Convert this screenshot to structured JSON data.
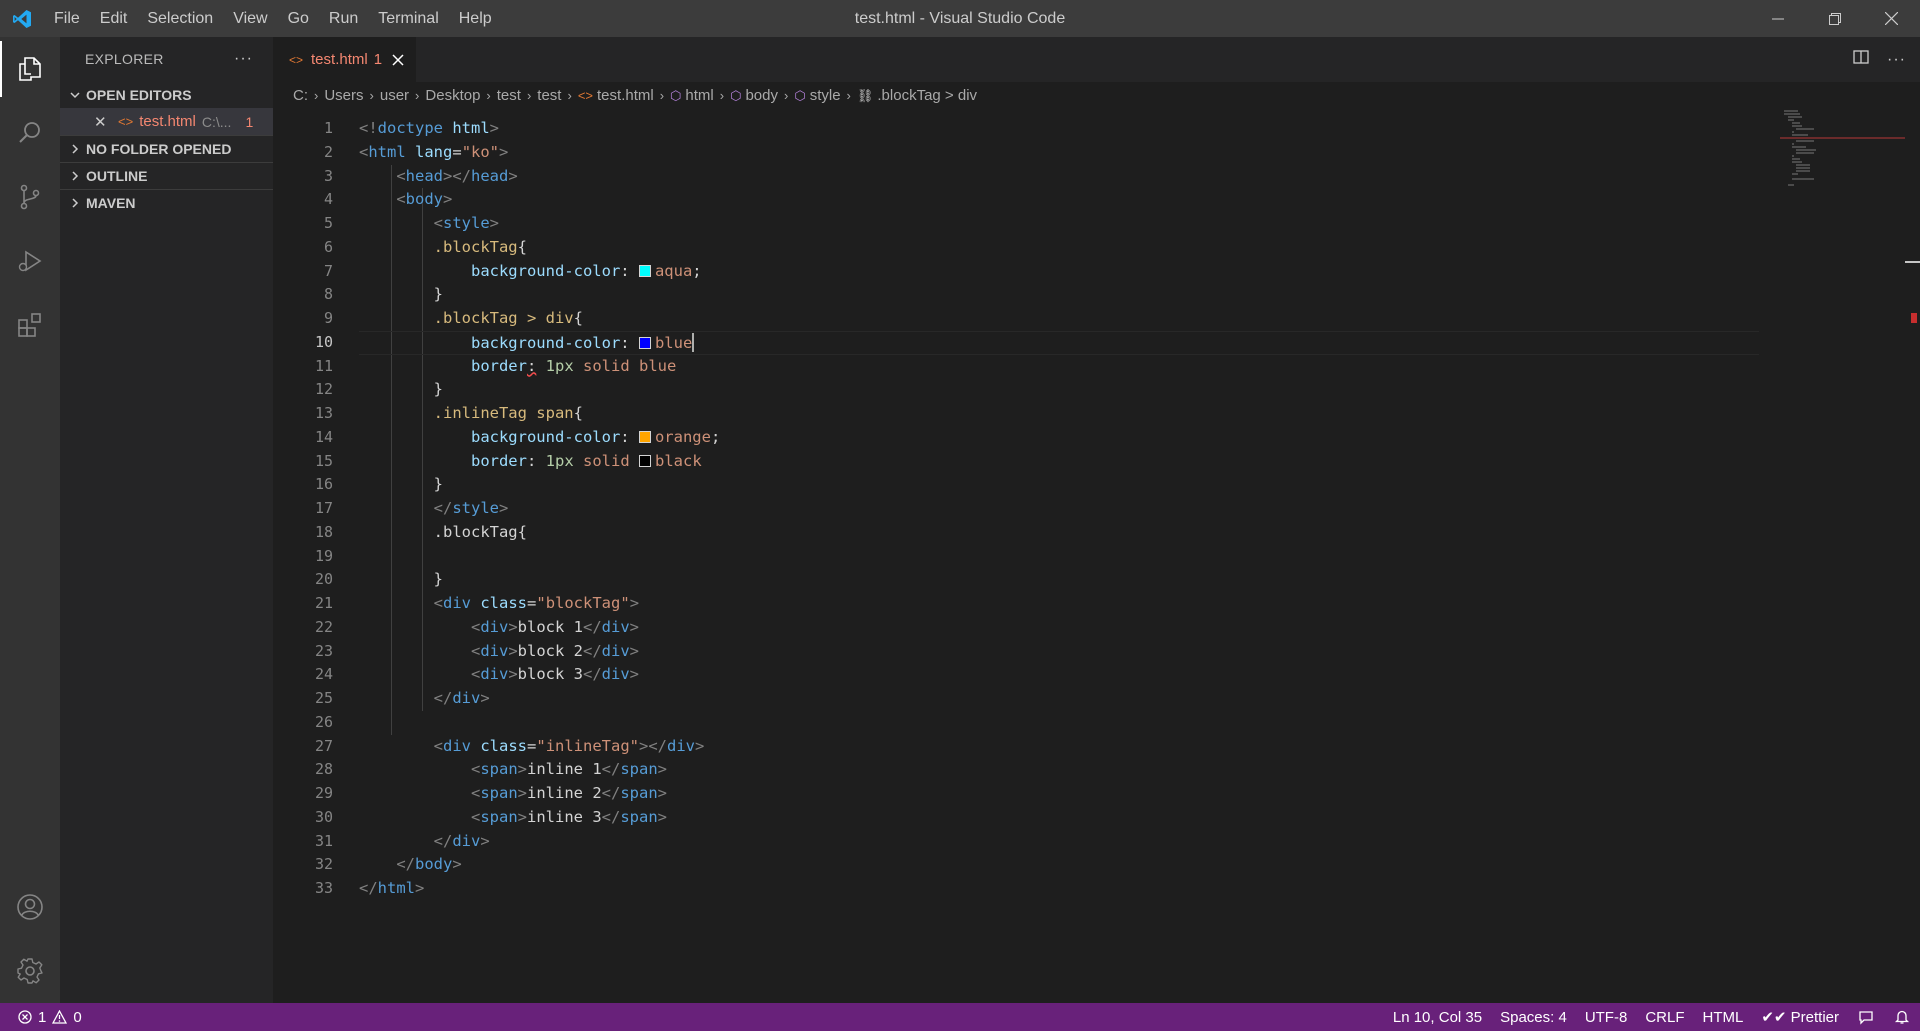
{
  "window": {
    "title": "test.html - Visual Studio Code",
    "menu": [
      "File",
      "Edit",
      "Selection",
      "View",
      "Go",
      "Run",
      "Terminal",
      "Help"
    ]
  },
  "sidebar": {
    "title": "EXPLORER",
    "more": "···",
    "sections": {
      "open_editors": "OPEN EDITORS",
      "no_folder": "NO FOLDER OPENED",
      "outline": "OUTLINE",
      "maven": "MAVEN"
    },
    "open_editor": {
      "name": "test.html",
      "path": "C:\\...",
      "badge": "1"
    }
  },
  "tab": {
    "name": "test.html",
    "badge": "1"
  },
  "breadcrumb": [
    "C:",
    "Users",
    "user",
    "Desktop",
    "test",
    "test",
    "test.html",
    "html",
    "body",
    "style",
    ".blockTag > div"
  ],
  "editor": {
    "current_line": 10,
    "lines": [
      [
        [
          "punc",
          "<!"
        ],
        [
          "tag",
          "doctype"
        ],
        [
          "text",
          " "
        ],
        [
          "attr",
          "html"
        ],
        [
          "punc",
          ">"
        ]
      ],
      [
        [
          "punc",
          "<"
        ],
        [
          "tag",
          "html"
        ],
        [
          "text",
          " "
        ],
        [
          "attr",
          "lang"
        ],
        [
          "text",
          "="
        ],
        [
          "str",
          "\"ko\""
        ],
        [
          "punc",
          ">"
        ]
      ],
      [
        [
          "text",
          "    "
        ],
        [
          "punc",
          "<"
        ],
        [
          "tag",
          "head"
        ],
        [
          "punc",
          "></"
        ],
        [
          "tag",
          "head"
        ],
        [
          "punc",
          ">"
        ]
      ],
      [
        [
          "text",
          "    "
        ],
        [
          "punc",
          "<"
        ],
        [
          "tag",
          "body"
        ],
        [
          "punc",
          ">"
        ]
      ],
      [
        [
          "text",
          "        "
        ],
        [
          "punc",
          "<"
        ],
        [
          "tag",
          "style"
        ],
        [
          "punc",
          ">"
        ]
      ],
      [
        [
          "text",
          "        "
        ],
        [
          "sel",
          ".blockTag"
        ],
        [
          "text",
          "{"
        ]
      ],
      [
        [
          "text",
          "            "
        ],
        [
          "prop",
          "background-color"
        ],
        [
          "text",
          ": "
        ],
        [
          "swatch",
          "#00ffff"
        ],
        [
          "val",
          "aqua"
        ],
        [
          "text",
          ";"
        ]
      ],
      [
        [
          "text",
          "        "
        ],
        [
          "text",
          "}"
        ]
      ],
      [
        [
          "text",
          "        "
        ],
        [
          "sel",
          ".blockTag > div"
        ],
        [
          "text",
          "{"
        ]
      ],
      [
        [
          "text",
          "            "
        ],
        [
          "prop",
          "background-color"
        ],
        [
          "text",
          ": "
        ],
        [
          "swatch",
          "#0000ff"
        ],
        [
          "val",
          "blue"
        ],
        [
          "caret",
          ""
        ]
      ],
      [
        [
          "text",
          "            "
        ],
        [
          "prop",
          "border"
        ],
        [
          "squig",
          ":"
        ],
        [
          "text",
          " "
        ],
        [
          "num",
          "1px"
        ],
        [
          "text",
          " "
        ],
        [
          "val",
          "solid blue"
        ]
      ],
      [
        [
          "text",
          "        "
        ],
        [
          "text",
          "}"
        ]
      ],
      [
        [
          "text",
          "        "
        ],
        [
          "sel",
          ".inlineTag span"
        ],
        [
          "text",
          "{"
        ]
      ],
      [
        [
          "text",
          "            "
        ],
        [
          "prop",
          "background-color"
        ],
        [
          "text",
          ": "
        ],
        [
          "swatch",
          "#ffa500"
        ],
        [
          "val",
          "orange"
        ],
        [
          "text",
          ";"
        ]
      ],
      [
        [
          "text",
          "            "
        ],
        [
          "prop",
          "border"
        ],
        [
          "text",
          ": "
        ],
        [
          "num",
          "1px"
        ],
        [
          "text",
          " "
        ],
        [
          "val",
          "solid "
        ],
        [
          "swatch",
          "#000000"
        ],
        [
          "val",
          "black"
        ]
      ],
      [
        [
          "text",
          "        "
        ],
        [
          "text",
          "}"
        ]
      ],
      [
        [
          "text",
          "        "
        ],
        [
          "punc",
          "</"
        ],
        [
          "tag",
          "style"
        ],
        [
          "punc",
          ">"
        ]
      ],
      [
        [
          "text",
          "        "
        ],
        [
          "text",
          ".blockTag{"
        ]
      ],
      [
        [
          "text",
          ""
        ]
      ],
      [
        [
          "text",
          "        "
        ],
        [
          "text",
          "}"
        ]
      ],
      [
        [
          "text",
          "        "
        ],
        [
          "punc",
          "<"
        ],
        [
          "tag",
          "div"
        ],
        [
          "text",
          " "
        ],
        [
          "attr",
          "class"
        ],
        [
          "text",
          "="
        ],
        [
          "str",
          "\"blockTag\""
        ],
        [
          "punc",
          ">"
        ]
      ],
      [
        [
          "text",
          "            "
        ],
        [
          "punc",
          "<"
        ],
        [
          "tag",
          "div"
        ],
        [
          "punc",
          ">"
        ],
        [
          "text",
          "block 1"
        ],
        [
          "punc",
          "</"
        ],
        [
          "tag",
          "div"
        ],
        [
          "punc",
          ">"
        ]
      ],
      [
        [
          "text",
          "            "
        ],
        [
          "punc",
          "<"
        ],
        [
          "tag",
          "div"
        ],
        [
          "punc",
          ">"
        ],
        [
          "text",
          "block 2"
        ],
        [
          "punc",
          "</"
        ],
        [
          "tag",
          "div"
        ],
        [
          "punc",
          ">"
        ]
      ],
      [
        [
          "text",
          "            "
        ],
        [
          "punc",
          "<"
        ],
        [
          "tag",
          "div"
        ],
        [
          "punc",
          ">"
        ],
        [
          "text",
          "block 3"
        ],
        [
          "punc",
          "</"
        ],
        [
          "tag",
          "div"
        ],
        [
          "punc",
          ">"
        ]
      ],
      [
        [
          "text",
          "        "
        ],
        [
          "punc",
          "</"
        ],
        [
          "tag",
          "div"
        ],
        [
          "punc",
          ">"
        ]
      ],
      [
        [
          "text",
          ""
        ]
      ],
      [
        [
          "text",
          "        "
        ],
        [
          "punc",
          "<"
        ],
        [
          "tag",
          "div"
        ],
        [
          "text",
          " "
        ],
        [
          "attr",
          "class"
        ],
        [
          "text",
          "="
        ],
        [
          "str",
          "\"inlineTag\""
        ],
        [
          "punc",
          "></"
        ],
        [
          "tag",
          "div"
        ],
        [
          "punc",
          ">"
        ]
      ],
      [
        [
          "text",
          "            "
        ],
        [
          "punc",
          "<"
        ],
        [
          "tag",
          "span"
        ],
        [
          "punc",
          ">"
        ],
        [
          "text",
          "inline 1"
        ],
        [
          "punc",
          "</"
        ],
        [
          "tag",
          "span"
        ],
        [
          "punc",
          ">"
        ]
      ],
      [
        [
          "text",
          "            "
        ],
        [
          "punc",
          "<"
        ],
        [
          "tag",
          "span"
        ],
        [
          "punc",
          ">"
        ],
        [
          "text",
          "inline 2"
        ],
        [
          "punc",
          "</"
        ],
        [
          "tag",
          "span"
        ],
        [
          "punc",
          ">"
        ]
      ],
      [
        [
          "text",
          "            "
        ],
        [
          "punc",
          "<"
        ],
        [
          "tag",
          "span"
        ],
        [
          "punc",
          ">"
        ],
        [
          "text",
          "inline 3"
        ],
        [
          "punc",
          "</"
        ],
        [
          "tag",
          "span"
        ],
        [
          "punc",
          ">"
        ]
      ],
      [
        [
          "text",
          "        "
        ],
        [
          "punc",
          "</"
        ],
        [
          "tag",
          "div"
        ],
        [
          "punc",
          ">"
        ]
      ],
      [
        [
          "text",
          "    "
        ],
        [
          "punc",
          "</"
        ],
        [
          "tag",
          "body"
        ],
        [
          "punc",
          ">"
        ]
      ],
      [
        [
          "punc",
          "</"
        ],
        [
          "tag",
          "html"
        ],
        [
          "punc",
          ">"
        ]
      ]
    ]
  },
  "status": {
    "errors": "1",
    "warnings": "0",
    "position": "Ln 10, Col 35",
    "spaces": "Spaces: 4",
    "encoding": "UTF-8",
    "eol": "CRLF",
    "language": "HTML",
    "formatter": "Prettier"
  },
  "colors": {
    "statusbar": "#68217a",
    "titlebar": "#3c3c3c",
    "activitybar": "#333333",
    "sidebar": "#252526",
    "editor": "#1e1e1e",
    "accent": "#007acc"
  }
}
